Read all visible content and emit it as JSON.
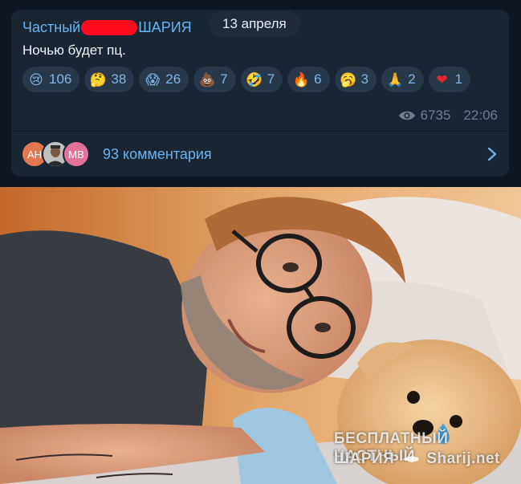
{
  "post": {
    "channel_name_left": "Частный",
    "channel_name_right": "ШАРИЯ",
    "date": "13 апреля",
    "text": "Ночью будет пц.",
    "views": "6735",
    "time": "22:06"
  },
  "reactions": [
    {
      "emoji": "😢",
      "count": "106"
    },
    {
      "emoji": "🤔",
      "count": "38"
    },
    {
      "emoji": "😱",
      "count": "26"
    },
    {
      "emoji": "💩",
      "count": "7"
    },
    {
      "emoji": "🤣",
      "count": "7"
    },
    {
      "emoji": "🔥",
      "count": "6"
    },
    {
      "emoji": "🥱",
      "count": "3"
    },
    {
      "emoji": "🙏",
      "count": "2"
    },
    {
      "emoji": "❤",
      "count": "1"
    }
  ],
  "comments": {
    "avatars": [
      {
        "initials": "АН",
        "color": "#e5764f"
      },
      {
        "initials": "",
        "color": "#d8d8d8"
      },
      {
        "initials": "МВ",
        "color": "#e37299"
      }
    ],
    "label": "93 комментария"
  },
  "watermark": {
    "line1": "БЕСПЛАТНЫЙ ЧАСТНЫЙ",
    "line2_left": "ШАРИЯ",
    "line2_right": "Sharij.net"
  },
  "colors": {
    "background": "#0e1621",
    "bubble": "#182533",
    "accent": "#6ab3f3",
    "redaction": "#ff0b1d"
  }
}
